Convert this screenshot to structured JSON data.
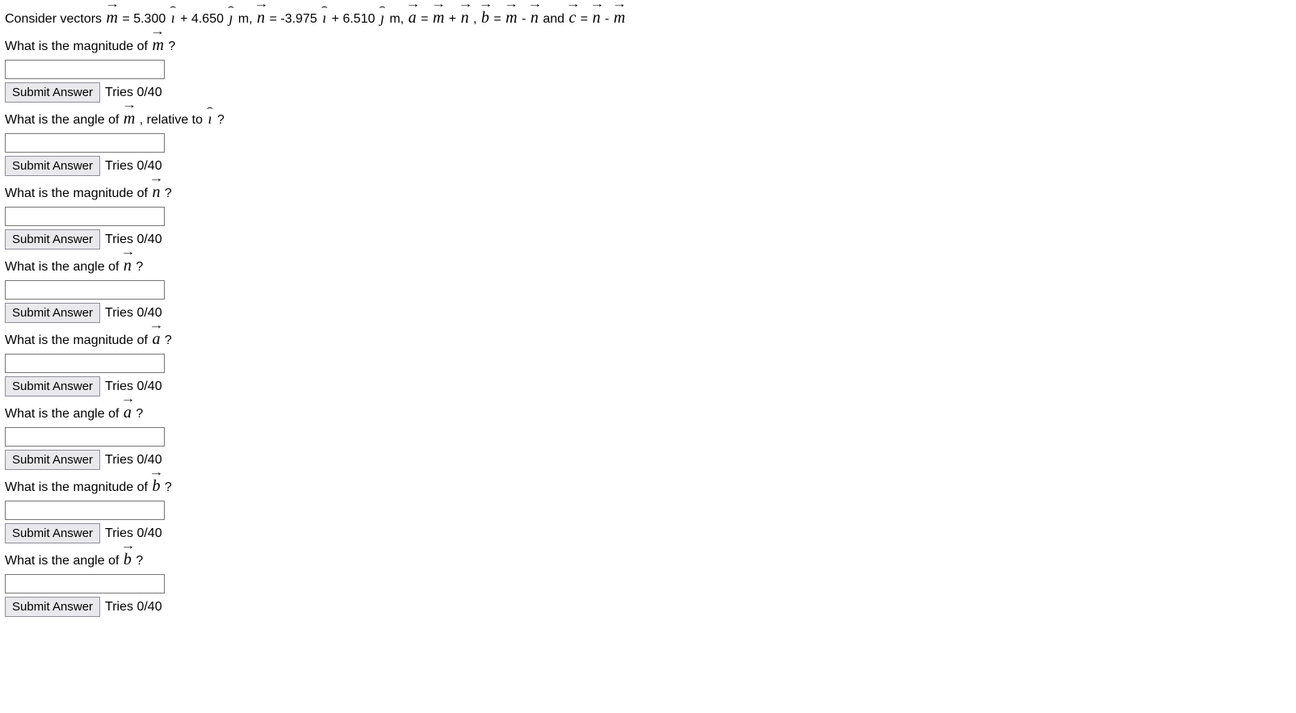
{
  "intro": {
    "p1": "Consider vectors ",
    "m_eq": " = 5.300 ",
    "m_plus": " + 4.650 ",
    "m_unit": " m, ",
    "n_eq": " = -3.975 ",
    "n_plus": " + 6.510 ",
    "n_unit": " m, ",
    "a_eq": " = ",
    "a_plus": " + ",
    "comma1": " , ",
    "b_eq": " = ",
    "b_minus": " - ",
    "and": " and ",
    "c_eq": " = ",
    "c_minus": " - "
  },
  "q1": {
    "prompt_a": "What is the magnitude of ",
    "prompt_b": " ?",
    "submit": "Submit Answer",
    "tries": "Tries 0/40"
  },
  "q2": {
    "prompt_a": "What is the angle of ",
    "prompt_b": " , relative to  ",
    "prompt_c": " ?",
    "submit": "Submit Answer",
    "tries": "Tries 0/40"
  },
  "q3": {
    "prompt_a": "What is the magnitude of ",
    "prompt_b": " ?",
    "submit": "Submit Answer",
    "tries": "Tries 0/40"
  },
  "q4": {
    "prompt_a": "What is the angle of ",
    "prompt_b": " ?",
    "submit": "Submit Answer",
    "tries": "Tries 0/40"
  },
  "q5": {
    "prompt_a": "What is the magnitude of ",
    "prompt_b": " ?",
    "submit": "Submit Answer",
    "tries": "Tries 0/40"
  },
  "q6": {
    "prompt_a": "What is the angle of ",
    "prompt_b": " ?",
    "submit": "Submit Answer",
    "tries": "Tries 0/40"
  },
  "q7": {
    "prompt_a": "What is the magnitude of ",
    "prompt_b": "?",
    "submit": "Submit Answer",
    "tries": "Tries 0/40"
  },
  "q8": {
    "prompt_a": "What is the angle of ",
    "prompt_b": "?",
    "submit": "Submit Answer",
    "tries": "Tries 0/40"
  },
  "sym": {
    "m": "m",
    "n": "n",
    "a": "a",
    "b": "b",
    "c": "c",
    "i": "ı",
    "j": "ȷ"
  }
}
